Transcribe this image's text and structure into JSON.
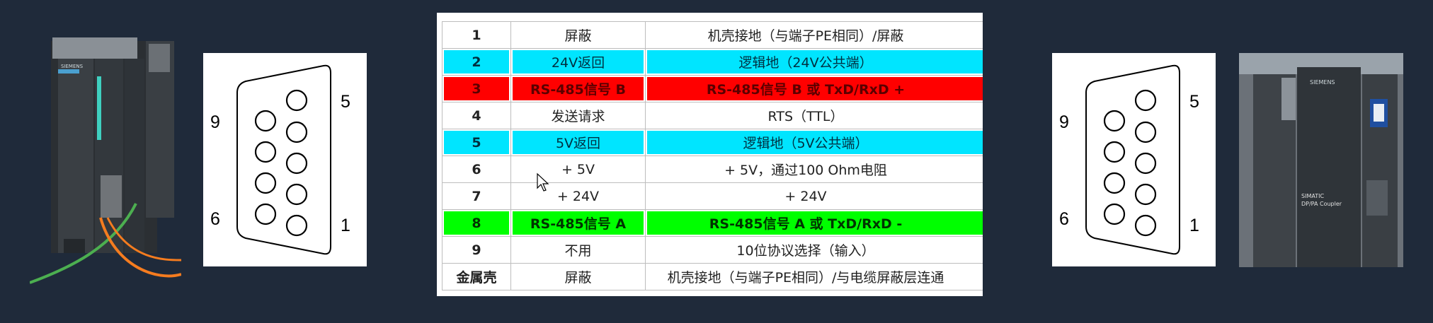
{
  "left_connector": {
    "pin_top_right": "5",
    "pin_top_left": "9",
    "pin_bottom_left": "6",
    "pin_bottom_right": "1"
  },
  "right_connector": {
    "pin_top_right": "5",
    "pin_top_left": "9",
    "pin_bottom_left": "6",
    "pin_bottom_right": "1"
  },
  "right_device": {
    "brand": "SIEMENS",
    "label_line1": "SIMATIC",
    "label_line2": "DP/PA Coupler"
  },
  "left_device": {
    "brand": "SIEMENS"
  },
  "pin_table": [
    {
      "pin": "1",
      "signal": "屏蔽",
      "desc": "机壳接地（与端子PE相同）/屏蔽",
      "style": "white"
    },
    {
      "pin": "2",
      "signal": "24V返回",
      "desc": "逻辑地（24V公共端）",
      "style": "cyan"
    },
    {
      "pin": "3",
      "signal": "RS-485信号 B",
      "desc": "RS-485信号 B 或 TxD/RxD +",
      "style": "red"
    },
    {
      "pin": "4",
      "signal": "发送请求",
      "desc": "RTS（TTL）",
      "style": "white"
    },
    {
      "pin": "5",
      "signal": "5V返回",
      "desc": "逻辑地（5V公共端）",
      "style": "cyan"
    },
    {
      "pin": "6",
      "signal": "+ 5V",
      "desc": "+ 5V，通过100 Ohm电阻",
      "style": "white"
    },
    {
      "pin": "7",
      "signal": "+ 24V",
      "desc": "+ 24V",
      "style": "white"
    },
    {
      "pin": "8",
      "signal": "RS-485信号 A",
      "desc": "RS-485信号 A 或 TxD/RxD -",
      "style": "green"
    },
    {
      "pin": "9",
      "signal": "不用",
      "desc": "10位协议选择（输入）",
      "style": "white"
    },
    {
      "pin": "金属壳",
      "signal": "屏蔽",
      "desc": "机壳接地（与端子PE相同）/与电缆屏蔽层连通",
      "style": "white"
    }
  ],
  "colors": {
    "background": "#1f2a3a",
    "cyan_row": "#00e5ff",
    "red_row": "#ff0000",
    "green_row": "#00ff00"
  }
}
